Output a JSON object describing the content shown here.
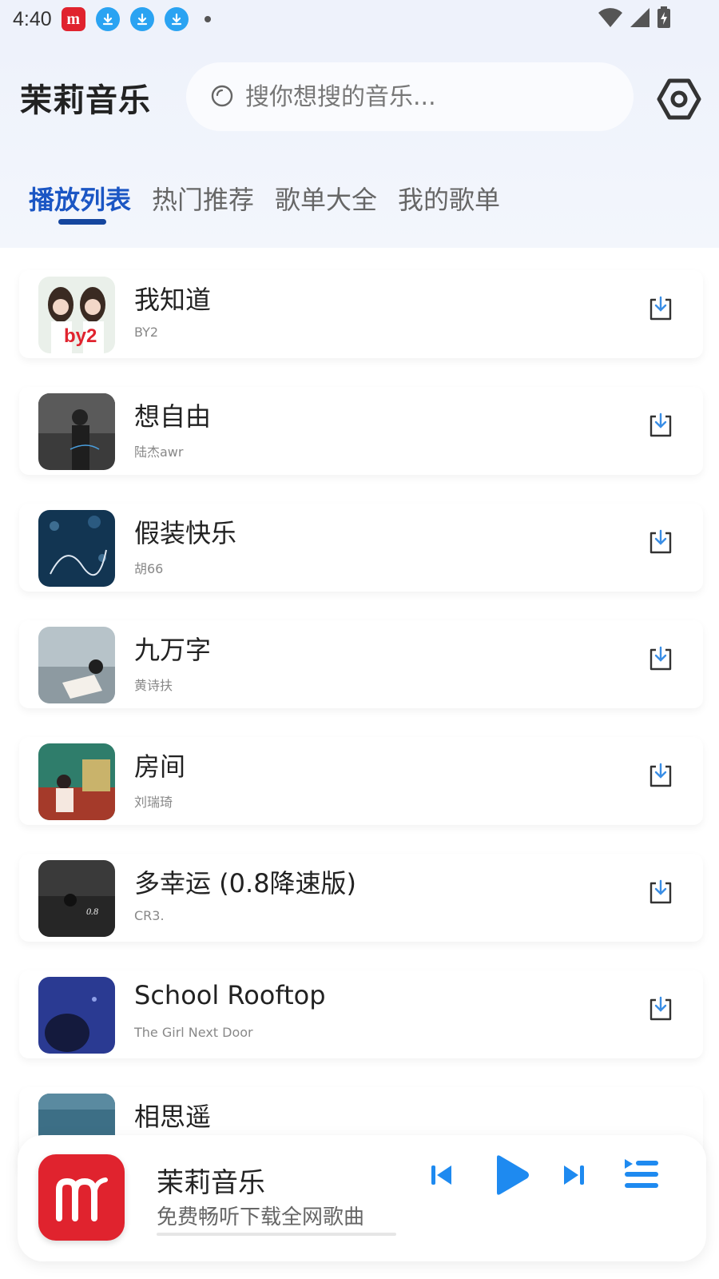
{
  "status_bar": {
    "time": "4:40",
    "icons": [
      "app-notification-icon",
      "download-icon",
      "download-icon",
      "download-icon",
      "dot-icon",
      "wifi-icon",
      "signal-icon",
      "battery-charging-icon"
    ]
  },
  "header": {
    "title": "茉莉音乐",
    "search_placeholder": "搜你想搜的音乐...",
    "accent_color": "#1b56c4"
  },
  "tabs": [
    {
      "label": "播放列表",
      "active": true
    },
    {
      "label": "热门推荐",
      "active": false
    },
    {
      "label": "歌单大全",
      "active": false
    },
    {
      "label": "我的歌单",
      "active": false
    }
  ],
  "songs": [
    {
      "title": "我知道",
      "artist": "BY2"
    },
    {
      "title": "想自由",
      "artist": "陆杰awr"
    },
    {
      "title": "假装快乐",
      "artist": "胡66"
    },
    {
      "title": "九万字",
      "artist": "黄诗扶"
    },
    {
      "title": "房间",
      "artist": "刘瑞琦"
    },
    {
      "title": "多幸运 (0.8降速版)",
      "artist": "CR3."
    },
    {
      "title": "School Rooftop",
      "artist": "The Girl Next Door"
    },
    {
      "title": "相思遥",
      "artist": ""
    }
  ],
  "player": {
    "title": "茉莉音乐",
    "subtitle": "免费畅听下载全网歌曲",
    "progress": 0,
    "brand_color": "#e0232e",
    "control_color": "#1e8af0"
  }
}
